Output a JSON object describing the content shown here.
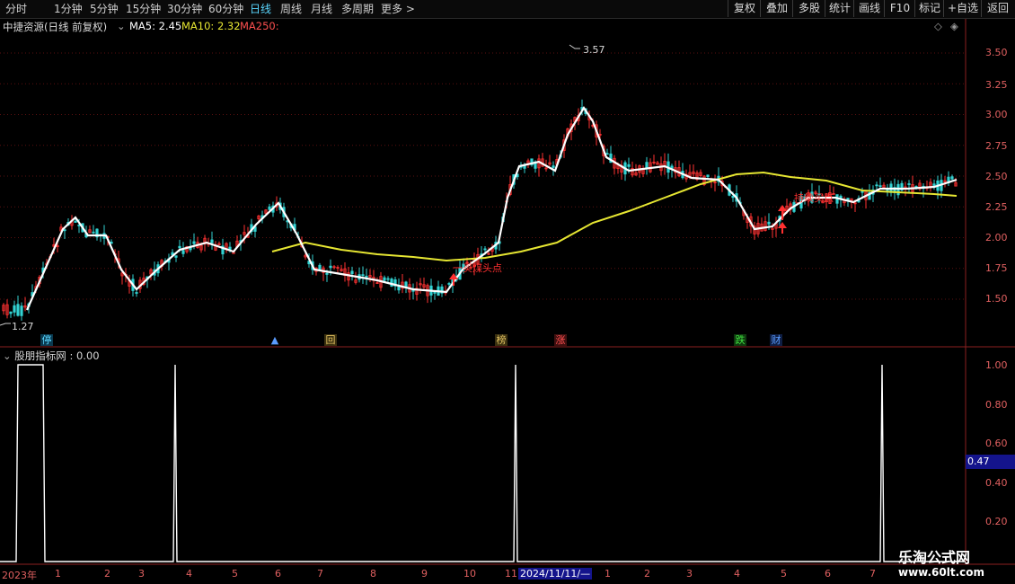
{
  "toolbar": {
    "periods": [
      "分时",
      "1分钟",
      "5分钟",
      "15分钟",
      "30分钟",
      "60分钟",
      "日线",
      "周线",
      "月线",
      "多周期",
      "更多 >"
    ],
    "active_period": "日线",
    "right_buttons": [
      "复权",
      "叠加",
      "多股",
      "统计",
      "画线",
      "F10",
      "+自选",
      "返回"
    ],
    "extra": "标记"
  },
  "chart_header": {
    "stock": "中捷资源(日线 前复权)",
    "ma5": "MA5: 2.45",
    "ma10": "MA10: 2.32",
    "ma250": "MA250:"
  },
  "price_axis": [
    "3.50",
    "3.25",
    "3.00",
    "2.75",
    "2.50",
    "2.25",
    "2.00",
    "1.75",
    "1.50"
  ],
  "price_marks": {
    "high": "3.57",
    "low": "1.27"
  },
  "annotations": {
    "bull_start": "一买煤头点",
    "mid_text": "持续买点"
  },
  "signals": [
    {
      "label": "停",
      "color": "#5ad7ff"
    },
    {
      "label": "▲",
      "color": "#5a9cff"
    },
    {
      "label": "回",
      "color": "#e0c060"
    },
    {
      "label": "榜",
      "color": "#e0c060"
    },
    {
      "label": "涨",
      "color": "#ff5050"
    },
    {
      "label": "跌",
      "color": "#40e040"
    },
    {
      "label": "财",
      "color": "#5a9cff"
    }
  ],
  "indicator": {
    "title": "股朋指标网 : 0.00",
    "axis": [
      "1.00",
      "0.80",
      "0.60",
      "0.40",
      "0.20"
    ],
    "current": "0.47"
  },
  "dates": [
    "2023年",
    "1",
    "2",
    "3",
    "4",
    "5",
    "6",
    "7",
    "8",
    "9",
    "10",
    "11",
    "2024/11/11/—",
    "1",
    "2",
    "3",
    "4",
    "5",
    "6",
    "7"
  ],
  "watermark": {
    "cn": "乐淘公式网",
    "url": "www.60lt.com"
  },
  "colors": {
    "up": "#ff3232",
    "down": "#32d2d2",
    "ma5": "#ffffff",
    "ma250": "#e6e632",
    "axis": "#e06060"
  }
}
